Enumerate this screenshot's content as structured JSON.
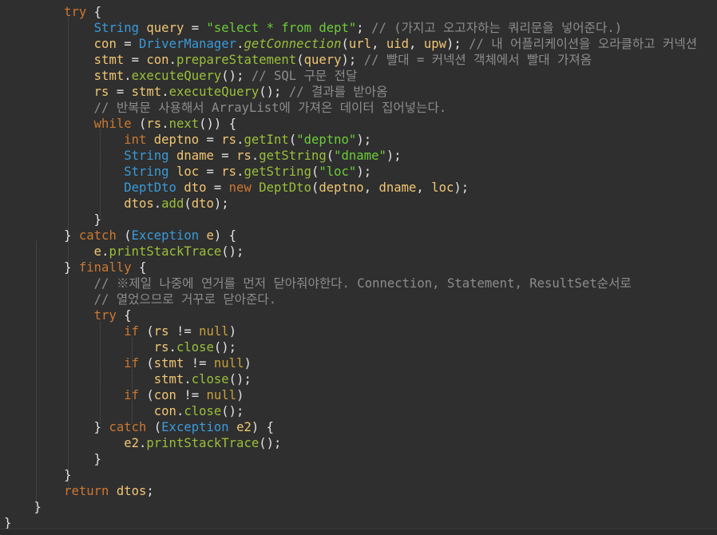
{
  "editor": {
    "background": "#2f2f2f",
    "lines": [
      [
        {
          "t": "        "
        },
        {
          "t": "try",
          "c": "kw"
        },
        {
          "t": " {"
        }
      ],
      [
        {
          "t": "            "
        },
        {
          "t": "String",
          "c": "ty"
        },
        {
          "t": " "
        },
        {
          "t": "query",
          "c": "vr"
        },
        {
          "t": " = "
        },
        {
          "t": "\"select * from dept\"",
          "c": "st"
        },
        {
          "t": "; "
        },
        {
          "t": "// (가지고 오고자하는 쿼리문을 넣어준다.)",
          "c": "cm"
        }
      ],
      [
        {
          "t": "            "
        },
        {
          "t": "con",
          "c": "vr"
        },
        {
          "t": " = "
        },
        {
          "t": "DriverManager",
          "c": "ty"
        },
        {
          "t": "."
        },
        {
          "t": "getConnection",
          "c": "it"
        },
        {
          "t": "("
        },
        {
          "t": "url",
          "c": "vr"
        },
        {
          "t": ", "
        },
        {
          "t": "uid",
          "c": "vr"
        },
        {
          "t": ", "
        },
        {
          "t": "upw",
          "c": "vr"
        },
        {
          "t": "); "
        },
        {
          "t": "// 내 어플리케이션을 오라클하고 커넥션",
          "c": "cm"
        }
      ],
      [
        {
          "t": "            "
        },
        {
          "t": "stmt",
          "c": "vr"
        },
        {
          "t": " = "
        },
        {
          "t": "con",
          "c": "vr"
        },
        {
          "t": "."
        },
        {
          "t": "prepareStatement",
          "c": "fn"
        },
        {
          "t": "("
        },
        {
          "t": "query",
          "c": "vr"
        },
        {
          "t": "); "
        },
        {
          "t": "// 빨대 = 커넥션 객체에서 빨대 가져옴",
          "c": "cm"
        }
      ],
      [
        {
          "t": "            "
        },
        {
          "t": "stmt",
          "c": "vr"
        },
        {
          "t": "."
        },
        {
          "t": "executeQuery",
          "c": "fn"
        },
        {
          "t": "(); "
        },
        {
          "t": "// SQL 구문 전달",
          "c": "cm"
        }
      ],
      [
        {
          "t": "            "
        },
        {
          "t": "rs",
          "c": "vr"
        },
        {
          "t": " = "
        },
        {
          "t": "stmt",
          "c": "vr"
        },
        {
          "t": "."
        },
        {
          "t": "executeQuery",
          "c": "fn"
        },
        {
          "t": "(); "
        },
        {
          "t": "// 결과를 받아옴",
          "c": "cm"
        }
      ],
      [
        {
          "t": "            "
        },
        {
          "t": "// 반복문 사용해서 ArrayList에 가져온 데이터 집어넣는다.",
          "c": "cm"
        }
      ],
      [
        {
          "t": "            "
        },
        {
          "t": "while",
          "c": "kw"
        },
        {
          "t": " ("
        },
        {
          "t": "rs",
          "c": "vr"
        },
        {
          "t": "."
        },
        {
          "t": "next",
          "c": "fn"
        },
        {
          "t": "()) {"
        }
      ],
      [
        {
          "t": "                "
        },
        {
          "t": "int",
          "c": "kw"
        },
        {
          "t": " "
        },
        {
          "t": "deptno",
          "c": "vr"
        },
        {
          "t": " = "
        },
        {
          "t": "rs",
          "c": "vr"
        },
        {
          "t": "."
        },
        {
          "t": "getInt",
          "c": "fn"
        },
        {
          "t": "("
        },
        {
          "t": "\"deptno\"",
          "c": "st"
        },
        {
          "t": ");"
        }
      ],
      [
        {
          "t": "                "
        },
        {
          "t": "String",
          "c": "ty"
        },
        {
          "t": " "
        },
        {
          "t": "dname",
          "c": "vr"
        },
        {
          "t": " = "
        },
        {
          "t": "rs",
          "c": "vr"
        },
        {
          "t": "."
        },
        {
          "t": "getString",
          "c": "fn"
        },
        {
          "t": "("
        },
        {
          "t": "\"dname\"",
          "c": "st"
        },
        {
          "t": ");"
        }
      ],
      [
        {
          "t": "                "
        },
        {
          "t": "String",
          "c": "ty"
        },
        {
          "t": " "
        },
        {
          "t": "loc",
          "c": "vr"
        },
        {
          "t": " = "
        },
        {
          "t": "rs",
          "c": "vr"
        },
        {
          "t": "."
        },
        {
          "t": "getString",
          "c": "fn"
        },
        {
          "t": "("
        },
        {
          "t": "\"loc\"",
          "c": "st"
        },
        {
          "t": ");"
        }
      ],
      [
        {
          "t": "                "
        },
        {
          "t": "DeptDto",
          "c": "ty"
        },
        {
          "t": " "
        },
        {
          "t": "dto",
          "c": "vr"
        },
        {
          "t": " = "
        },
        {
          "t": "new",
          "c": "kw"
        },
        {
          "t": " "
        },
        {
          "t": "DeptDto",
          "c": "fn"
        },
        {
          "t": "("
        },
        {
          "t": "deptno",
          "c": "vr"
        },
        {
          "t": ", "
        },
        {
          "t": "dname",
          "c": "vr"
        },
        {
          "t": ", "
        },
        {
          "t": "loc",
          "c": "vr"
        },
        {
          "t": ");"
        }
      ],
      [
        {
          "t": "                "
        },
        {
          "t": "dtos",
          "c": "vr"
        },
        {
          "t": "."
        },
        {
          "t": "add",
          "c": "fn"
        },
        {
          "t": "("
        },
        {
          "t": "dto",
          "c": "vr"
        },
        {
          "t": ");"
        }
      ],
      [
        {
          "t": "            }"
        }
      ],
      [
        {
          "t": "        } "
        },
        {
          "t": "catch",
          "c": "kw"
        },
        {
          "t": " ("
        },
        {
          "t": "Exception",
          "c": "ty"
        },
        {
          "t": " "
        },
        {
          "t": "e",
          "c": "vr"
        },
        {
          "t": ") {"
        }
      ],
      [
        {
          "t": "            "
        },
        {
          "t": "e",
          "c": "vr"
        },
        {
          "t": "."
        },
        {
          "t": "printStackTrace",
          "c": "fn"
        },
        {
          "t": "();"
        }
      ],
      [
        {
          "t": "        } "
        },
        {
          "t": "finally",
          "c": "kw"
        },
        {
          "t": " {"
        }
      ],
      [
        {
          "t": "            "
        },
        {
          "t": "// ※제일 나중에 연거를 먼저 닫아줘야한다. Connection, Statement, ResultSet순서로",
          "c": "cm"
        }
      ],
      [
        {
          "t": "            "
        },
        {
          "t": "// 열었으므로 거꾸로 닫아준다.",
          "c": "cm"
        }
      ],
      [
        {
          "t": "            "
        },
        {
          "t": "try",
          "c": "kw"
        },
        {
          "t": " {"
        }
      ],
      [
        {
          "t": "                "
        },
        {
          "t": "if",
          "c": "kw"
        },
        {
          "t": " ("
        },
        {
          "t": "rs",
          "c": "vr"
        },
        {
          "t": " != "
        },
        {
          "t": "null",
          "c": "nl"
        },
        {
          "t": ")"
        }
      ],
      [
        {
          "t": "                    "
        },
        {
          "t": "rs",
          "c": "vr"
        },
        {
          "t": "."
        },
        {
          "t": "close",
          "c": "fn"
        },
        {
          "t": "();"
        }
      ],
      [
        {
          "t": "                "
        },
        {
          "t": "if",
          "c": "kw"
        },
        {
          "t": " ("
        },
        {
          "t": "stmt",
          "c": "vr"
        },
        {
          "t": " != "
        },
        {
          "t": "null",
          "c": "nl"
        },
        {
          "t": ")"
        }
      ],
      [
        {
          "t": "                    "
        },
        {
          "t": "stmt",
          "c": "vr"
        },
        {
          "t": "."
        },
        {
          "t": "close",
          "c": "fn"
        },
        {
          "t": "();"
        }
      ],
      [
        {
          "t": "                "
        },
        {
          "t": "if",
          "c": "kw"
        },
        {
          "t": " ("
        },
        {
          "t": "con",
          "c": "vr"
        },
        {
          "t": " != "
        },
        {
          "t": "null",
          "c": "nl"
        },
        {
          "t": ")"
        }
      ],
      [
        {
          "t": "                    "
        },
        {
          "t": "con",
          "c": "vr"
        },
        {
          "t": "."
        },
        {
          "t": "close",
          "c": "fn"
        },
        {
          "t": "();"
        }
      ],
      [
        {
          "t": "            } "
        },
        {
          "t": "catch",
          "c": "kw"
        },
        {
          "t": " ("
        },
        {
          "t": "Exception",
          "c": "ty"
        },
        {
          "t": " "
        },
        {
          "t": "e2",
          "c": "vr"
        },
        {
          "t": ") {"
        }
      ],
      [
        {
          "t": "                "
        },
        {
          "t": "e2",
          "c": "vr"
        },
        {
          "t": "."
        },
        {
          "t": "printStackTrace",
          "c": "fn"
        },
        {
          "t": "();"
        }
      ],
      [
        {
          "t": "            }"
        }
      ],
      [
        {
          "t": "        }"
        }
      ],
      [
        {
          "t": "        "
        },
        {
          "t": "return",
          "c": "kw"
        },
        {
          "t": " "
        },
        {
          "t": "dtos",
          "c": "vr"
        },
        {
          "t": ";"
        }
      ],
      [
        {
          "t": "    }"
        }
      ],
      [
        {
          "t": "}"
        }
      ]
    ]
  }
}
